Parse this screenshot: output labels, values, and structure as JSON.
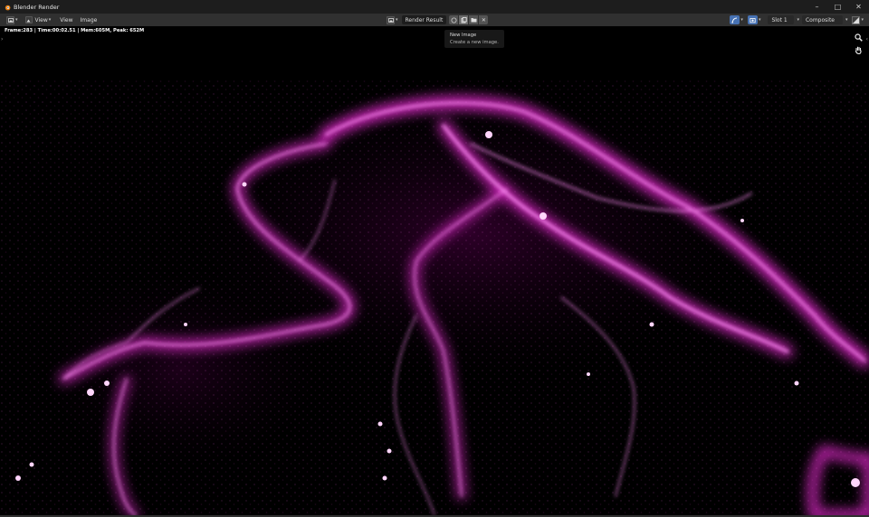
{
  "window": {
    "title": "Blender Render"
  },
  "header": {
    "view_menu": "View",
    "menus": [
      "View",
      "Image"
    ],
    "image_name": "Render Result",
    "slot": "Slot 1",
    "layer": "Composite"
  },
  "stats": {
    "text": "Frame:283 | Time:00:02.51 | Mem:605M, Peak: 652M"
  },
  "tooltip": {
    "title": "New Image",
    "description": "Create a new image."
  },
  "colors": {
    "glow": "#ff33ee",
    "accent": "#4772b3",
    "header": "#303030"
  }
}
